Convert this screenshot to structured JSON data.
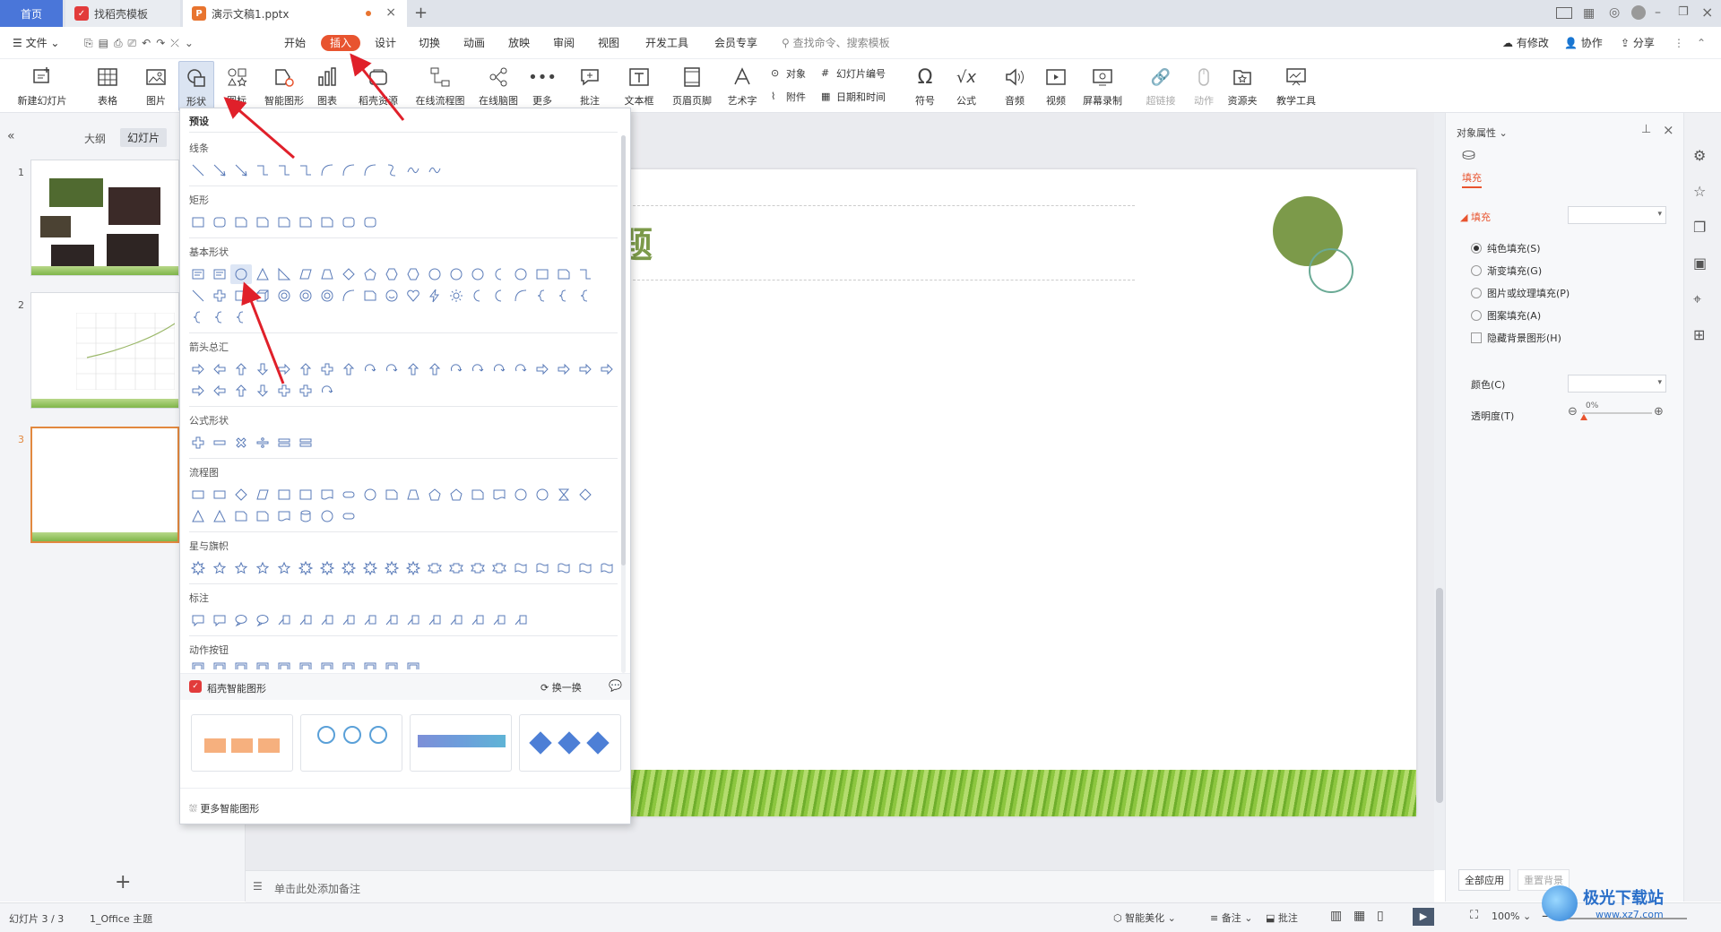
{
  "tabs": {
    "home": "首页",
    "template": "找稻壳模板",
    "doc": "演示文稿1.pptx"
  },
  "menu": {
    "file": "文件",
    "items": [
      "开始",
      "插入",
      "设计",
      "切换",
      "动画",
      "放映",
      "审阅",
      "视图",
      "开发工具",
      "会员专享"
    ],
    "search_placeholder": "查找命令、搜索模板",
    "has_changes": "有修改",
    "collab": "协作",
    "share": "分享"
  },
  "ribbon": {
    "new_slide": "新建幻灯片",
    "table": "表格",
    "picture": "图片",
    "shape": "形状",
    "icon": "图标",
    "smart_shape": "智能图形",
    "chart": "图表",
    "docer_res": "稻壳资源",
    "online_flow": "在线流程图",
    "online_mind": "在线脑图",
    "more": "更多",
    "comment": "批注",
    "textbox": "文本框",
    "header_footer": "页眉页脚",
    "wordart": "艺术字",
    "object": "对象",
    "slide_number": "幻灯片编号",
    "attachment": "附件",
    "date_time": "日期和时间",
    "symbol": "符号",
    "formula": "公式",
    "audio": "音频",
    "video": "视频",
    "screen_record": "屏幕录制",
    "hyperlink": "超链接",
    "action": "动作",
    "resource": "资源夹",
    "teaching": "教学工具"
  },
  "left_panel": {
    "outline": "大纲",
    "slides": "幻灯片",
    "slide_numbers": [
      "1",
      "2",
      "3"
    ]
  },
  "popup": {
    "preset": "预设",
    "sections": {
      "lines": "线条",
      "rect": "矩形",
      "basic": "基本形状",
      "arrows": "箭头总汇",
      "formula": "公式形状",
      "flow": "流程图",
      "stars": "星与旗帜",
      "callouts": "标注",
      "actions": "动作按钮"
    },
    "smart_title": "稻壳智能图形",
    "refresh": "换一换",
    "more_smart": "更多智能图形"
  },
  "slide": {
    "title_fragment": "题",
    "accent": "#7c9a4a"
  },
  "notes": {
    "placeholder": "单击此处添加备注"
  },
  "right_panel": {
    "title": "对象属性",
    "fill_tab": "填充",
    "fill_header": "填充",
    "options": [
      "纯色填充(S)",
      "渐变填充(G)",
      "图片或纹理填充(P)",
      "图案填充(A)"
    ],
    "hide_bg": "隐藏背景图形(H)",
    "color": "颜色(C)",
    "transparency": "透明度(T)",
    "transparency_value": "0%",
    "apply_all": "全部应用",
    "reset_bg": "重置背景"
  },
  "status": {
    "slide_info": "幻灯片 3 / 3",
    "theme": "1_Office 主题",
    "beautify": "智能美化",
    "notes": "备注",
    "comment": "批注",
    "zoom": "100%"
  },
  "watermark": {
    "name": "极光下载站",
    "url": "www.xz7.com"
  },
  "colors": {
    "brand_orange": "#e8542f",
    "home_tab": "#4a76d9",
    "annotation_red": "#e0202a"
  }
}
